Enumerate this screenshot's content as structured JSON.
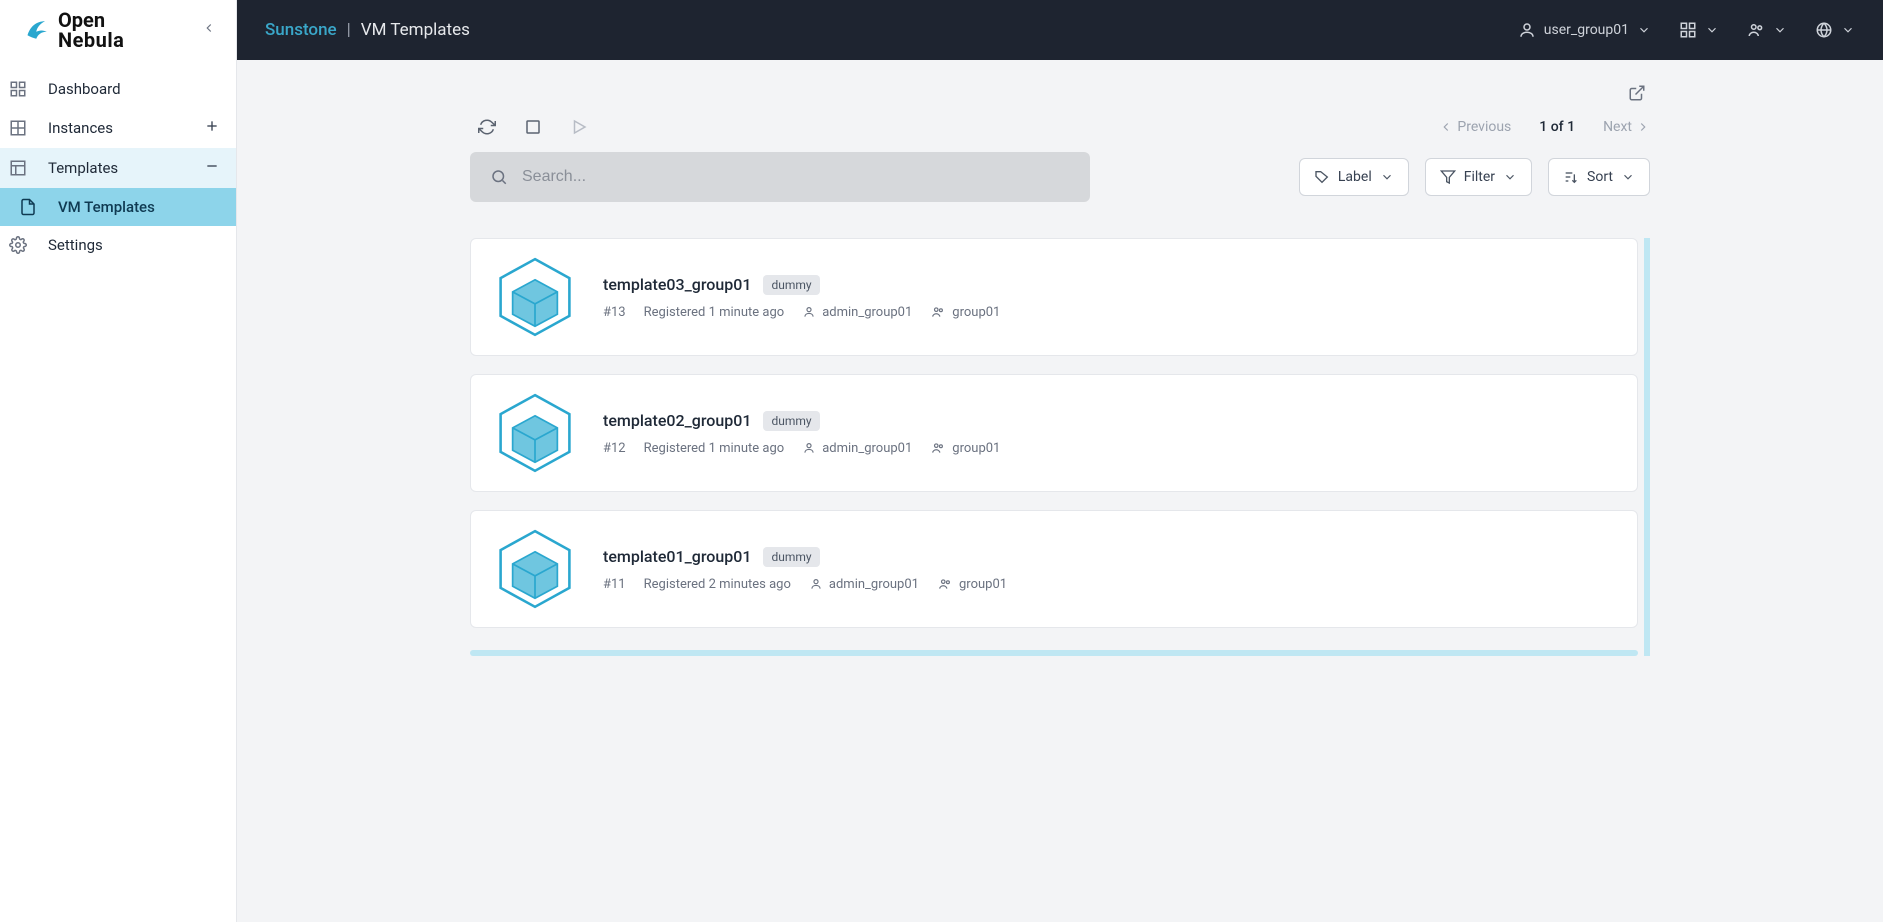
{
  "logo": {
    "line1": "Open",
    "line2": "Nebula"
  },
  "sidebar": {
    "items": [
      {
        "label": "Dashboard"
      },
      {
        "label": "Instances"
      },
      {
        "label": "Templates"
      },
      {
        "label": "VM Templates"
      },
      {
        "label": "Settings"
      }
    ]
  },
  "breadcrumb": {
    "app": "Sunstone",
    "sep": "|",
    "page": "VM Templates"
  },
  "topbar": {
    "user": "user_group01"
  },
  "pager": {
    "prev": "Previous",
    "current": "1 of 1",
    "next": "Next"
  },
  "search": {
    "placeholder": "Search..."
  },
  "controls": {
    "label": "Label",
    "filter": "Filter",
    "sort": "Sort"
  },
  "templates": [
    {
      "name": "template03_group01",
      "badge": "dummy",
      "id": "#13",
      "registered": "Registered 1 minute ago",
      "owner": "admin_group01",
      "group": "group01"
    },
    {
      "name": "template02_group01",
      "badge": "dummy",
      "id": "#12",
      "registered": "Registered 1 minute ago",
      "owner": "admin_group01",
      "group": "group01"
    },
    {
      "name": "template01_group01",
      "badge": "dummy",
      "id": "#11",
      "registered": "Registered 2 minutes ago",
      "owner": "admin_group01",
      "group": "group01"
    }
  ]
}
